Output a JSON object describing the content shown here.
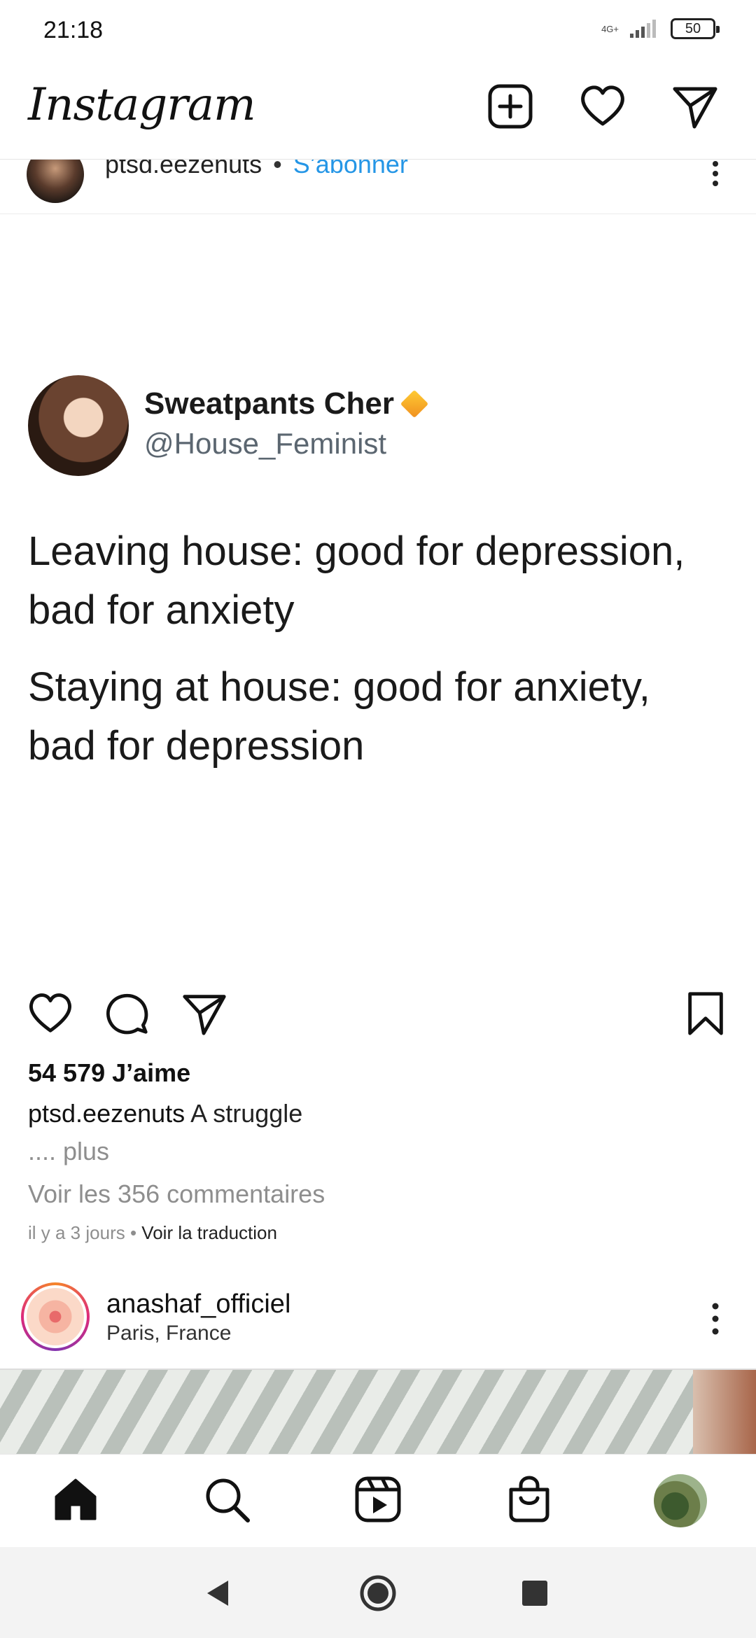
{
  "status_bar": {
    "time": "21:18",
    "network": "4G+",
    "battery": "50"
  },
  "header": {
    "logo": "Instagram",
    "icons": [
      "new-post-icon",
      "heart-icon",
      "direct-message-icon"
    ]
  },
  "post": {
    "username": "ptsd.eezenuts",
    "separator": "•",
    "follow_label": "S’abonner",
    "image": {
      "tweet_name": "Sweatpants Cher",
      "tweet_handle": "@House_Feminist",
      "line1": "Leaving house: good for depression,",
      "line2": "bad for anxiety",
      "line3": "Staying at house: good for anxiety,",
      "line4": "bad for depression"
    },
    "likes": "54 579 J’aime",
    "caption_user": "ptsd.eezenuts",
    "caption_text": " A struggle",
    "more_label": ".... plus",
    "comments_label": "Voir les 356 commentaires",
    "time_ago": "il y a 3 jours",
    "time_sep": " • ",
    "translate_label": "Voir la traduction"
  },
  "next_post": {
    "username": "anashaf_officiel",
    "location": "Paris, France"
  },
  "bottom_nav": [
    "home-icon",
    "search-icon",
    "reels-icon",
    "shop-icon",
    "profile-avatar"
  ],
  "colors": {
    "link": "#2596e6",
    "muted": "#8e8e8e",
    "text": "#111111"
  }
}
